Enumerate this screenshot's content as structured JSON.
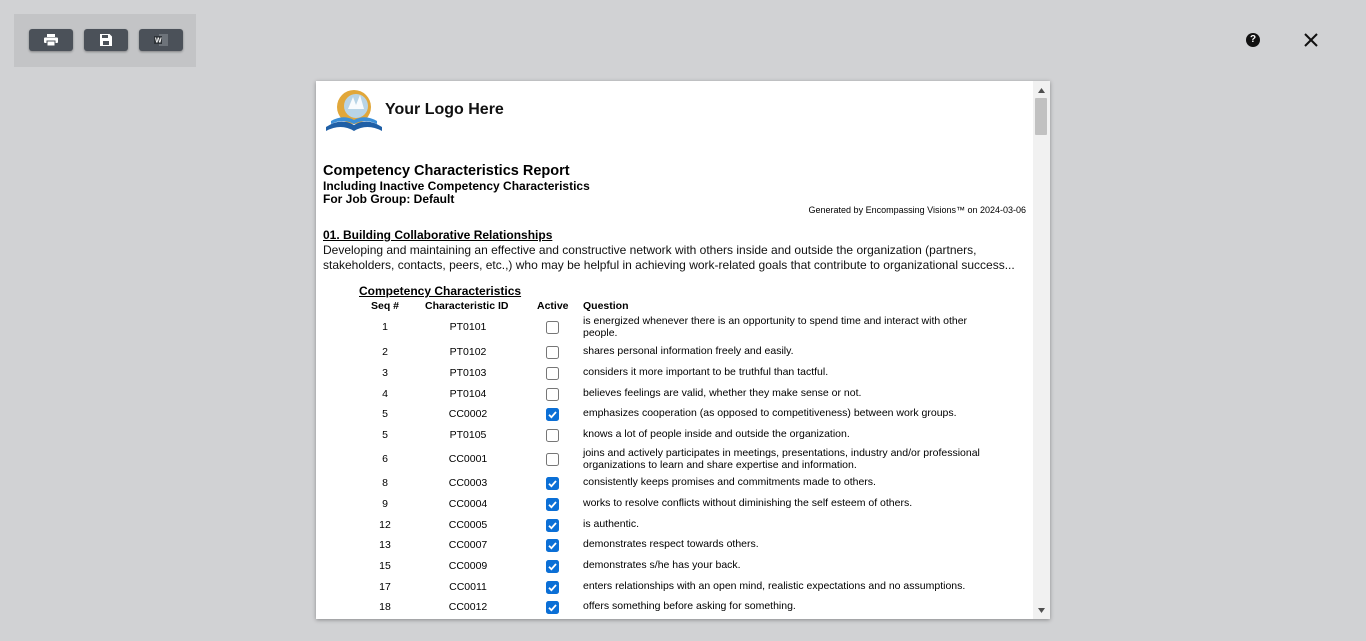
{
  "toolbar": {
    "print_icon": "print-icon",
    "save_icon": "floppy-disk-icon",
    "word_icon": "word-document-icon"
  },
  "header_controls": {
    "help_label": "?",
    "close_icon": "close-icon"
  },
  "report": {
    "logo_text": "Your Logo Here",
    "title": "Competency Characteristics Report",
    "subtitle1": "Including Inactive Competency Characteristics",
    "subtitle2": "For Job Group: Default",
    "generated": "Generated by Encompassing Visions™ on 2024-03-06",
    "section_title": "01. Building Collaborative Relationships",
    "section_desc": "Developing and maintaining an effective and constructive network with others inside and outside the organization (partners, stakeholders, contacts, peers, etc.,) who may be helpful in achieving work-related goals that contribute to organizational success...",
    "cc_heading": "Competency Characteristics",
    "columns": {
      "seq": "Seq #",
      "id": "Characteristic ID",
      "active": "Active",
      "question": "Question"
    },
    "rows": [
      {
        "seq": "1",
        "id": "PT0101",
        "active": false,
        "question": "is energized whenever there is an opportunity to spend time and interact with other people."
      },
      {
        "seq": "2",
        "id": "PT0102",
        "active": false,
        "question": "shares personal information freely and easily."
      },
      {
        "seq": "3",
        "id": "PT0103",
        "active": false,
        "question": "considers it more important to be truthful than tactful."
      },
      {
        "seq": "4",
        "id": "PT0104",
        "active": false,
        "question": "believes feelings are valid, whether they make sense or not."
      },
      {
        "seq": "5",
        "id": "CC0002",
        "active": true,
        "question": "emphasizes cooperation (as opposed to competitiveness) between work groups."
      },
      {
        "seq": "5",
        "id": "PT0105",
        "active": false,
        "question": "knows a lot of people inside and outside the organization."
      },
      {
        "seq": "6",
        "id": "CC0001",
        "active": false,
        "question": "joins and actively participates in meetings, presentations, industry and/or professional organizations to learn and share expertise and information."
      },
      {
        "seq": "8",
        "id": "CC0003",
        "active": true,
        "question": "consistently keeps promises and commitments made to others."
      },
      {
        "seq": "9",
        "id": "CC0004",
        "active": true,
        "question": "works to resolve conflicts without diminishing the self esteem of others."
      },
      {
        "seq": "12",
        "id": "CC0005",
        "active": true,
        "question": "is authentic."
      },
      {
        "seq": "13",
        "id": "CC0007",
        "active": true,
        "question": "demonstrates respect towards others."
      },
      {
        "seq": "15",
        "id": "CC0009",
        "active": true,
        "question": "demonstrates s/he has your back."
      },
      {
        "seq": "17",
        "id": "CC0011",
        "active": true,
        "question": "enters relationships with an open mind, realistic expectations and no assumptions."
      },
      {
        "seq": "18",
        "id": "CC0012",
        "active": true,
        "question": "offers something before asking for something."
      }
    ]
  }
}
